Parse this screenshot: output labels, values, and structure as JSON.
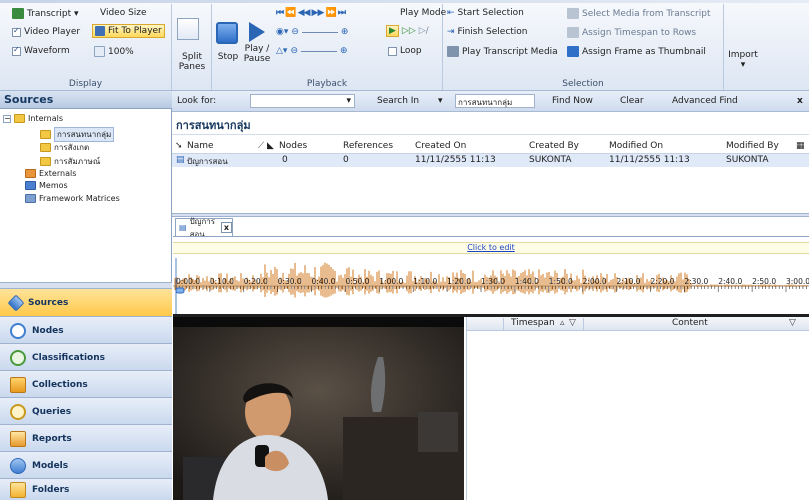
{
  "ribbon": {
    "display": {
      "group_label": "Display",
      "transcript": "Transcript ▾",
      "video_size": "Video Size",
      "video_player": "Video Player",
      "fit_to_player": "Fit To Player",
      "waveform": "Waveform",
      "zoom": "100%"
    },
    "split_panes": {
      "line1": "Split",
      "line2": "Panes"
    },
    "playback": {
      "group_label": "Playback",
      "stop": "Stop",
      "play_pause_1": "Play /",
      "play_pause_2": "Pause",
      "play_mode": "Play Mode",
      "loop": "Loop"
    },
    "selection": {
      "group_label": "Selection",
      "start_selection": "Start Selection",
      "finish_selection": "Finish Selection",
      "play_transcript_media": "Play Transcript Media",
      "select_media": "Select Media from Transcript",
      "assign_timespan": "Assign Timespan to Rows",
      "assign_frame": "Assign Frame as Thumbnail"
    },
    "import": {
      "label": "Import",
      "arrow": "▾"
    }
  },
  "sources_panel": {
    "title": "Sources",
    "tree": {
      "internals": "Internals",
      "child1": "การสนทนากลุ่ม",
      "child2": "การสังเกต",
      "child3": "การสัมภาษณ์",
      "externals": "Externals",
      "memos": "Memos",
      "framework": "Framework Matrices"
    }
  },
  "nav": {
    "sources": "Sources",
    "nodes": "Nodes",
    "classifications": "Classifications",
    "collections": "Collections",
    "queries": "Queries",
    "reports": "Reports",
    "models": "Models",
    "folders": "Folders"
  },
  "findbar": {
    "look_for": "Look for:",
    "search_in": "Search In",
    "search_in_value": "การสนทนากลุ่ม",
    "find_now": "Find Now",
    "clear": "Clear",
    "advanced_find": "Advanced Find",
    "close": "x"
  },
  "list": {
    "title": "การสนทนากลุ่ม",
    "columns": [
      "Name",
      "Nodes",
      "References",
      "Created On",
      "Created By",
      "Modified On",
      "Modified By"
    ],
    "rows": [
      {
        "name": "ปัญการสอน",
        "nodes": "0",
        "references": "0",
        "created_on": "11/11/2555 11:13",
        "created_by": "SUKONTA",
        "modified_on": "11/11/2555 11:13",
        "modified_by": "SUKONTA"
      }
    ]
  },
  "doc": {
    "tab_label": "ปัญการสอน",
    "tab_close": "x",
    "click_to_edit": "Click to edit",
    "timeline": [
      "0:00.0",
      "0:10.0",
      "0:20.0",
      "0:30.0",
      "0:40.0",
      "0:50.0",
      "1:00.0",
      "1:10.0",
      "1:20.0",
      "1:30.0",
      "1:40.0",
      "1:50.0",
      "2:00.0",
      "2:10.0",
      "2:20.0",
      "2:30.0",
      "2:40.0",
      "2:50.0",
      "3:00.0"
    ]
  },
  "transcript": {
    "col_timespan": "Timespan",
    "col_content": "Content"
  },
  "colors": {
    "accent": "#f0b73a",
    "waveform": "#d2791d",
    "nav_active": "#ffc94a"
  }
}
